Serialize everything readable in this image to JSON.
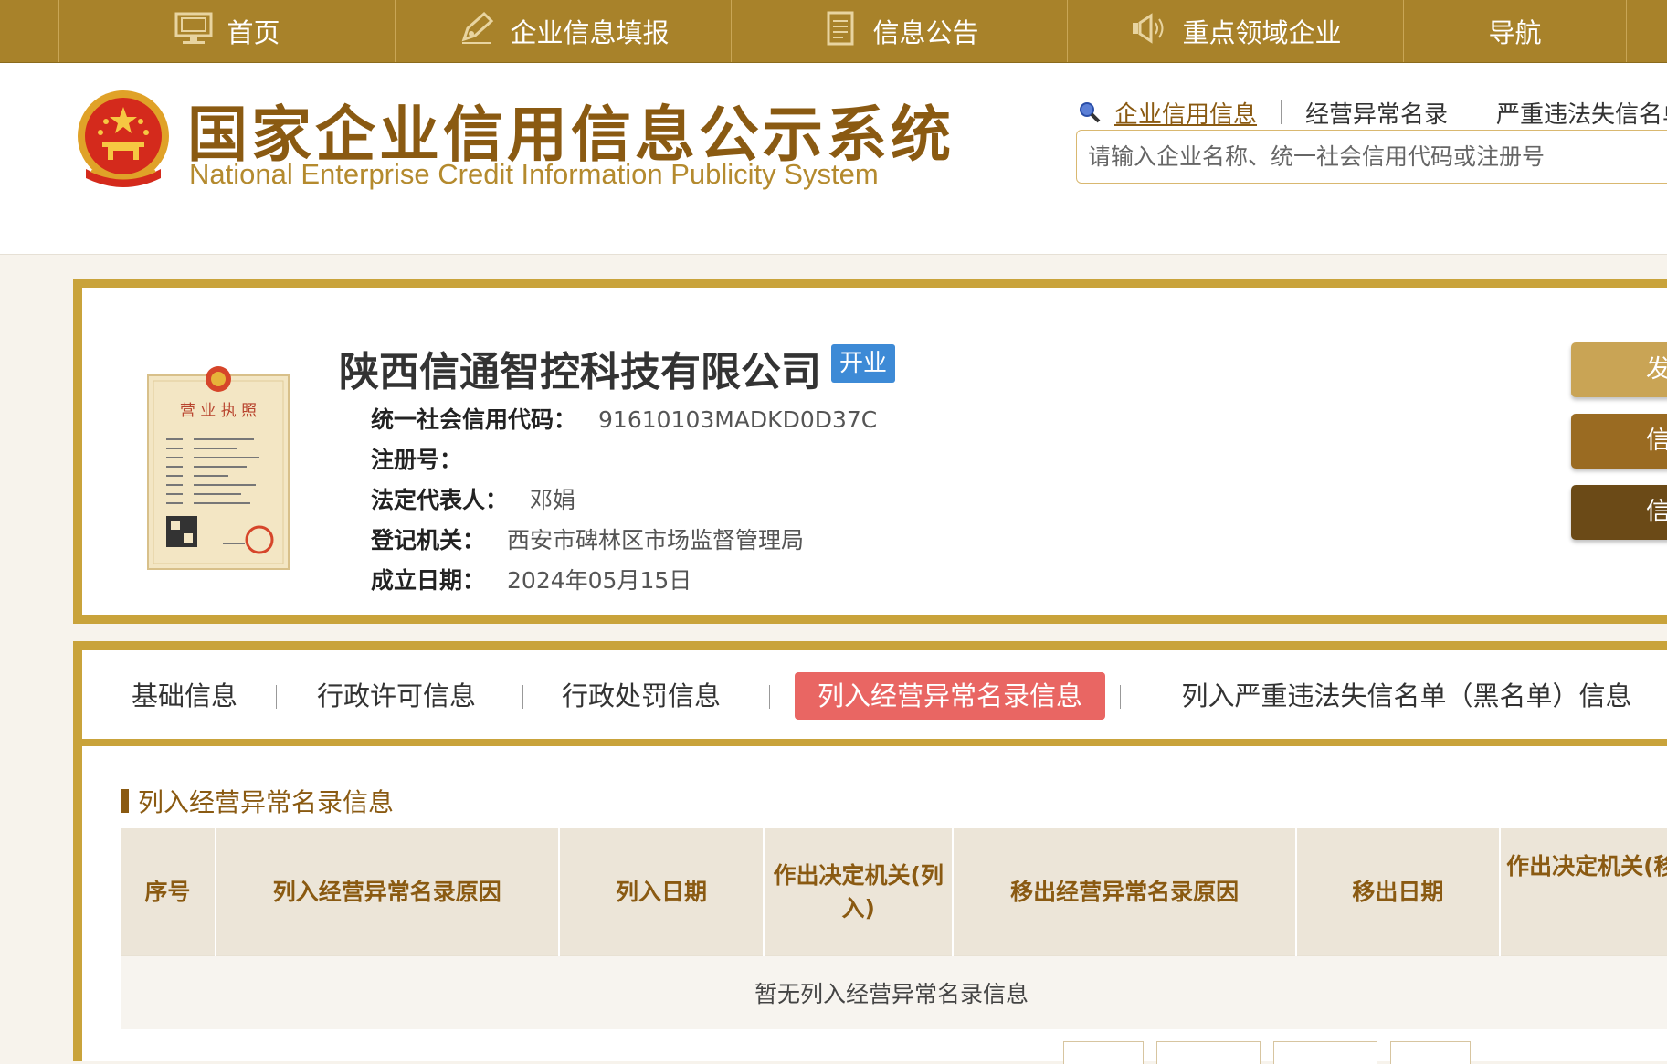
{
  "top_nav": {
    "items": [
      {
        "label": "首页",
        "icon": "monitor-icon"
      },
      {
        "label": "企业信息填报",
        "icon": "pen-icon"
      },
      {
        "label": "信息公告",
        "icon": "document-icon"
      },
      {
        "label": "重点领域企业",
        "icon": "speaker-icon"
      },
      {
        "label": "导航",
        "icon": ""
      }
    ]
  },
  "header": {
    "title_cn": "国家企业信用信息公示系统",
    "title_en": "National Enterprise Credit Information Publicity System",
    "search_tabs": [
      "企业信用信息",
      "经营异常名录",
      "严重违法失信名单"
    ],
    "search_placeholder": "请输入企业名称、统一社会信用代码或注册号"
  },
  "company": {
    "name": "陕西信通智控科技有限公司",
    "status": "开业",
    "license_image_text": "营 业 执 照",
    "fields": [
      {
        "label": "统一社会信用代码：",
        "value": "91610103MADKD0D37C"
      },
      {
        "label": "注册号：",
        "value": ""
      },
      {
        "label": "法定代表人：",
        "value": "邓娟"
      },
      {
        "label": "登记机关：",
        "value": "西安市碑林区市场监督管理局"
      },
      {
        "label": "成立日期：",
        "value": "2024年05月15日"
      }
    ],
    "side_buttons": [
      {
        "label": "发送报告",
        "color": "#c9a455"
      },
      {
        "label": "信息打印",
        "color": "#9a6b22"
      },
      {
        "label": "信息分享",
        "color": "#6b4a17"
      }
    ]
  },
  "tabs": {
    "items": [
      "基础信息",
      "行政许可信息",
      "行政处罚信息",
      "列入经营异常名录信息",
      "列入严重违法失信名单（黑名单）信息"
    ],
    "active_index": 3,
    "active_color": "#e96663"
  },
  "section": {
    "title": "列入经营异常名录信息",
    "table": {
      "headers": [
        "序号",
        "列入经营异常名录原因",
        "列入日期",
        "作出决定机关(列入)",
        "移出经营异常名录原因",
        "移出日期",
        "作出决定机关(移出)"
      ],
      "empty_text": "暂无列入经营异常名录信息"
    }
  },
  "colors": {
    "gold": "#a8822a",
    "brown": "#8a5a12",
    "border_gold": "#c9a33b"
  }
}
